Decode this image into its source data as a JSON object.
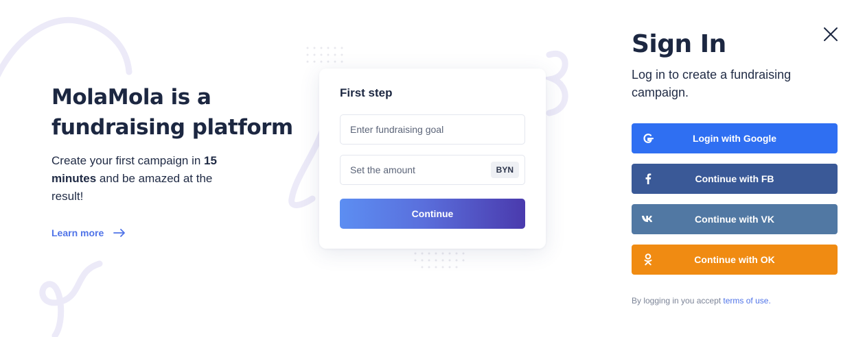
{
  "hero": {
    "title": "MolaMola is a fundraising platform",
    "subtitle_part1": "Create your first campaign in ",
    "subtitle_bold": "15 minutes",
    "subtitle_part2": " and be amazed at the result!",
    "learn_more": "Learn more"
  },
  "card": {
    "title": "First step",
    "goal_placeholder": "Enter fundraising goal",
    "amount_placeholder": "Set the amount",
    "currency": "BYN",
    "continue_label": "Continue"
  },
  "signin": {
    "title": "Sign In",
    "subtitle": "Log in to create a fundraising campaign.",
    "buttons": [
      {
        "label": "Login with Google",
        "icon": "google-icon",
        "color": "#2f6ff2"
      },
      {
        "label": "Continue with FB",
        "icon": "facebook-icon",
        "color": "#3a5997"
      },
      {
        "label": "Continue with VK",
        "icon": "vk-icon",
        "color": "#5178a3"
      },
      {
        "label": "Continue with OK",
        "icon": "odnoklassniki-icon",
        "color": "#f08b12"
      }
    ],
    "legal_prefix": "By logging in you accept ",
    "legal_link": "terms of use."
  },
  "colors": {
    "accent": "#4f73e8",
    "text_dark": "#1c2741"
  }
}
